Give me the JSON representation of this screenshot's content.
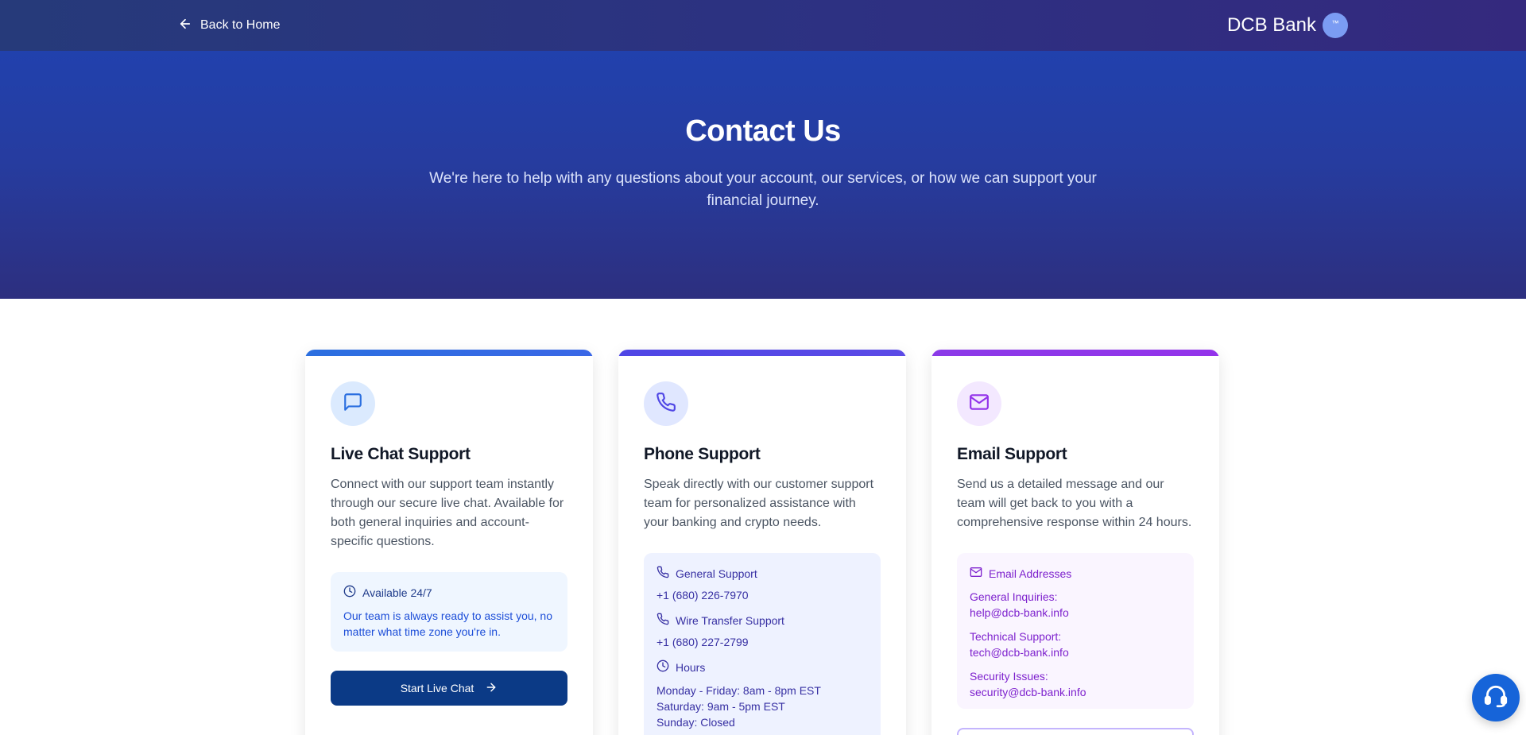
{
  "nav": {
    "back_label": "Back to Home",
    "brand_name": "DCB Bank",
    "brand_badge": "™"
  },
  "hero": {
    "title": "Contact Us",
    "subtitle": "We're here to help with any questions about your account, our services, or how we can support your financial journey."
  },
  "cards": {
    "live_chat": {
      "title": "Live Chat Support",
      "description": "Connect with our support team instantly through our secure live chat. Available for both general inquiries and account-specific questions.",
      "availability_label": "Available 24/7",
      "availability_text": "Our team is always ready to assist you, no matter what time zone you're in.",
      "button_label": "Start Live Chat"
    },
    "phone": {
      "title": "Phone Support",
      "description": "Speak directly with our customer support team for personalized assistance with your banking and crypto needs.",
      "general_label": "General Support",
      "general_number": "+1 (680) 226-7970",
      "wire_label": "Wire Transfer Support",
      "wire_number": "+1 (680) 227-2799",
      "hours_label": "Hours",
      "hours_weekday": "Monday - Friday: 8am - 8pm EST",
      "hours_saturday": "Saturday: 9am - 5pm EST",
      "hours_sunday": "Sunday: Closed"
    },
    "email": {
      "title": "Email Support",
      "description": "Send us a detailed message and our team will get back to you with a comprehensive response within 24 hours.",
      "addresses_label": "Email Addresses",
      "general_label": "General Inquiries:",
      "general_address": "help@dcb-bank.info",
      "technical_label": "Technical Support:",
      "technical_address": "tech@dcb-bank.info",
      "security_label": "Security Issues:",
      "security_address": "security@dcb-bank.info"
    }
  },
  "colors": {
    "chat_accent": "#2b6fe0",
    "phone_accent": "#5146e0",
    "email_accent": "#9333ea",
    "cta_button": "#0b3a86",
    "fab": "#1664d9"
  },
  "icons": {
    "back": "arrow-left-icon",
    "chat": "message-square-icon",
    "phone": "phone-icon",
    "email": "mail-icon",
    "clock": "clock-icon",
    "arrow": "arrow-right-icon",
    "fab": "headset-chat-icon"
  }
}
